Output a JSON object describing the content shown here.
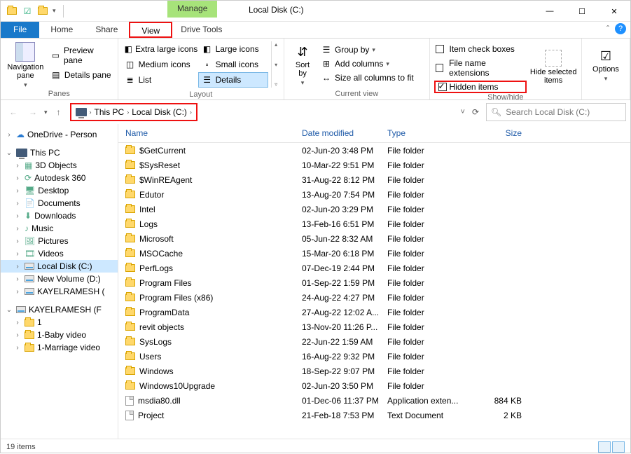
{
  "window": {
    "title": "Local Disk (C:)",
    "manage_tab": "Manage"
  },
  "tabs": {
    "file": "File",
    "home": "Home",
    "share": "Share",
    "view": "View",
    "drive_tools": "Drive Tools"
  },
  "ribbon": {
    "panes": {
      "nav": "Navigation\npane",
      "preview": "Preview pane",
      "details": "Details pane",
      "label": "Panes"
    },
    "layout": {
      "xl": "Extra large icons",
      "lg": "Large icons",
      "md": "Medium icons",
      "sm": "Small icons",
      "list": "List",
      "details": "Details",
      "label": "Layout"
    },
    "current": {
      "sort": "Sort\nby",
      "group": "Group by",
      "addcols": "Add columns",
      "sizeall": "Size all columns to fit",
      "label": "Current view"
    },
    "showhide": {
      "checkboxes": "Item check boxes",
      "ext": "File name extensions",
      "hidden": "Hidden items",
      "hidesel": "Hide selected\nitems",
      "label": "Show/hide"
    },
    "options": "Options"
  },
  "nav": {
    "this_pc": "This PC",
    "local_disk": "Local Disk (C:)",
    "search_ph": "Search Local Disk (C:)"
  },
  "tree": {
    "onedrive": "OneDrive - Person",
    "thispc": "This PC",
    "items": [
      "3D Objects",
      "Autodesk 360",
      "Desktop",
      "Documents",
      "Downloads",
      "Music",
      "Pictures",
      "Videos",
      "Local Disk (C:)",
      "New Volume (D:)",
      "KAYELRAMESH ("
    ],
    "removable": "KAYELRAMESH (F",
    "sub": [
      "1",
      "1-Baby video",
      "1-Marriage video"
    ]
  },
  "columns": {
    "name": "Name",
    "date": "Date modified",
    "type": "Type",
    "size": "Size"
  },
  "files": [
    {
      "n": "$GetCurrent",
      "d": "02-Jun-20 3:48 PM",
      "t": "File folder",
      "s": "",
      "k": "folder"
    },
    {
      "n": "$SysReset",
      "d": "10-Mar-22 9:51 PM",
      "t": "File folder",
      "s": "",
      "k": "folder"
    },
    {
      "n": "$WinREAgent",
      "d": "31-Aug-22 8:12 PM",
      "t": "File folder",
      "s": "",
      "k": "folder"
    },
    {
      "n": "Edutor",
      "d": "13-Aug-20 7:54 PM",
      "t": "File folder",
      "s": "",
      "k": "folder"
    },
    {
      "n": "Intel",
      "d": "02-Jun-20 3:29 PM",
      "t": "File folder",
      "s": "",
      "k": "folder"
    },
    {
      "n": "Logs",
      "d": "13-Feb-16 6:51 PM",
      "t": "File folder",
      "s": "",
      "k": "folder"
    },
    {
      "n": "Microsoft",
      "d": "05-Jun-22 8:32 AM",
      "t": "File folder",
      "s": "",
      "k": "folder"
    },
    {
      "n": "MSOCache",
      "d": "15-Mar-20 6:18 PM",
      "t": "File folder",
      "s": "",
      "k": "folder"
    },
    {
      "n": "PerfLogs",
      "d": "07-Dec-19 2:44 PM",
      "t": "File folder",
      "s": "",
      "k": "folder"
    },
    {
      "n": "Program Files",
      "d": "01-Sep-22 1:59 PM",
      "t": "File folder",
      "s": "",
      "k": "folder"
    },
    {
      "n": "Program Files (x86)",
      "d": "24-Aug-22 4:27 PM",
      "t": "File folder",
      "s": "",
      "k": "folder"
    },
    {
      "n": "ProgramData",
      "d": "27-Aug-22 12:02 A...",
      "t": "File folder",
      "s": "",
      "k": "folder"
    },
    {
      "n": "revit objects",
      "d": "13-Nov-20 11:26 P...",
      "t": "File folder",
      "s": "",
      "k": "folder"
    },
    {
      "n": "SysLogs",
      "d": "22-Jun-22 1:59 AM",
      "t": "File folder",
      "s": "",
      "k": "folder"
    },
    {
      "n": "Users",
      "d": "16-Aug-22 9:32 PM",
      "t": "File folder",
      "s": "",
      "k": "folder"
    },
    {
      "n": "Windows",
      "d": "18-Sep-22 9:07 PM",
      "t": "File folder",
      "s": "",
      "k": "folder"
    },
    {
      "n": "Windows10Upgrade",
      "d": "02-Jun-20 3:50 PM",
      "t": "File folder",
      "s": "",
      "k": "folder"
    },
    {
      "n": "msdia80.dll",
      "d": "01-Dec-06 11:37 PM",
      "t": "Application exten...",
      "s": "884 KB",
      "k": "file"
    },
    {
      "n": "Project",
      "d": "21-Feb-18 7:53 PM",
      "t": "Text Document",
      "s": "2 KB",
      "k": "file"
    }
  ],
  "status": {
    "count": "19 items"
  }
}
